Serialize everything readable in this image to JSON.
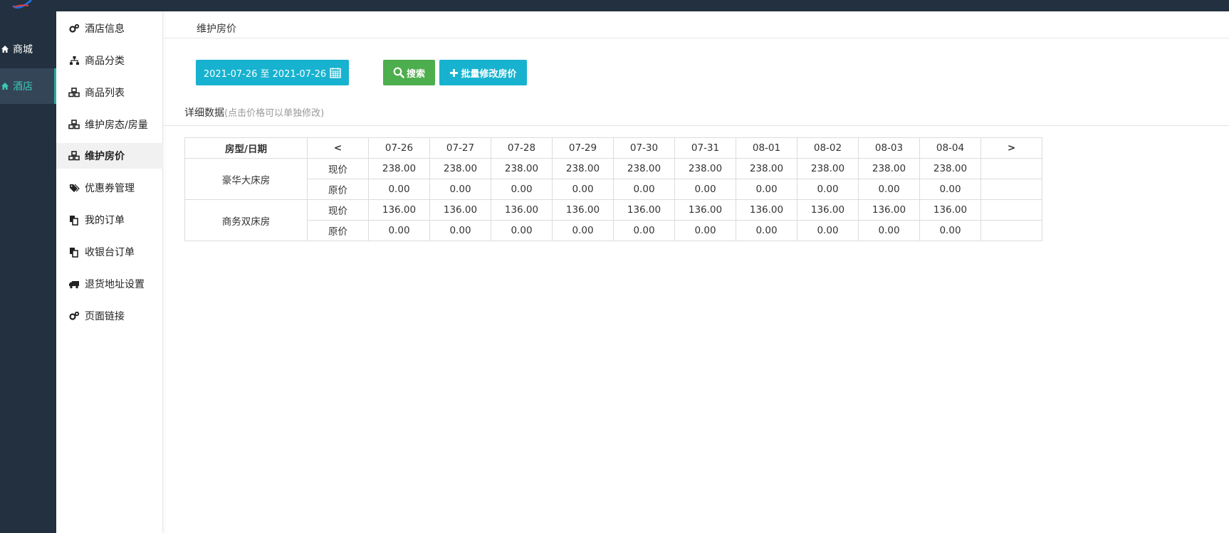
{
  "leftnav": {
    "items": [
      {
        "label": "商城",
        "icon": "home-icon"
      },
      {
        "label": "酒店",
        "icon": "home-icon",
        "active": true
      }
    ]
  },
  "subnav": {
    "items": [
      {
        "label": "酒店信息",
        "icon": "cogs-icon"
      },
      {
        "label": "商品分类",
        "icon": "sitemap-icon"
      },
      {
        "label": "商品列表",
        "icon": "cubes-icon"
      },
      {
        "label": "维护房态/房量",
        "icon": "cubes-icon"
      },
      {
        "label": "维护房价",
        "icon": "cubes-icon",
        "active": true
      },
      {
        "label": "优惠券管理",
        "icon": "tags-icon"
      },
      {
        "label": "我的订单",
        "icon": "copy-icon"
      },
      {
        "label": "收银台订单",
        "icon": "copy-icon"
      },
      {
        "label": "退货地址设置",
        "icon": "truck-icon"
      },
      {
        "label": "页面链接",
        "icon": "cogs-icon"
      }
    ]
  },
  "breadcrumb": "维护房价",
  "toolbar": {
    "date_range": "2021-07-26 至 2021-07-26",
    "search_label": "搜索",
    "batch_label": "批量修改房价"
  },
  "detail": {
    "title": "详细数据",
    "hint": "(点击价格可以单独修改)"
  },
  "table": {
    "header_type": "房型/日期",
    "prev": "<",
    "next": ">",
    "dates": [
      "07-26",
      "07-27",
      "07-28",
      "07-29",
      "07-30",
      "07-31",
      "08-01",
      "08-02",
      "08-03",
      "08-04"
    ],
    "rooms": [
      {
        "name": "豪华大床房",
        "rows": [
          {
            "label": "现价",
            "values": [
              "238.00",
              "238.00",
              "238.00",
              "238.00",
              "238.00",
              "238.00",
              "238.00",
              "238.00",
              "238.00",
              "238.00"
            ]
          },
          {
            "label": "原价",
            "values": [
              "0.00",
              "0.00",
              "0.00",
              "0.00",
              "0.00",
              "0.00",
              "0.00",
              "0.00",
              "0.00",
              "0.00"
            ]
          }
        ]
      },
      {
        "name": "商务双床房",
        "rows": [
          {
            "label": "现价",
            "values": [
              "136.00",
              "136.00",
              "136.00",
              "136.00",
              "136.00",
              "136.00",
              "136.00",
              "136.00",
              "136.00",
              "136.00"
            ]
          },
          {
            "label": "原价",
            "values": [
              "0.00",
              "0.00",
              "0.00",
              "0.00",
              "0.00",
              "0.00",
              "0.00",
              "0.00",
              "0.00",
              "0.00"
            ]
          }
        ]
      }
    ]
  },
  "colors": {
    "dark_nav": "#22303f",
    "accent_teal": "#17b2cf",
    "accent_green": "#4cae4c",
    "active_text": "#3ec7b7"
  }
}
